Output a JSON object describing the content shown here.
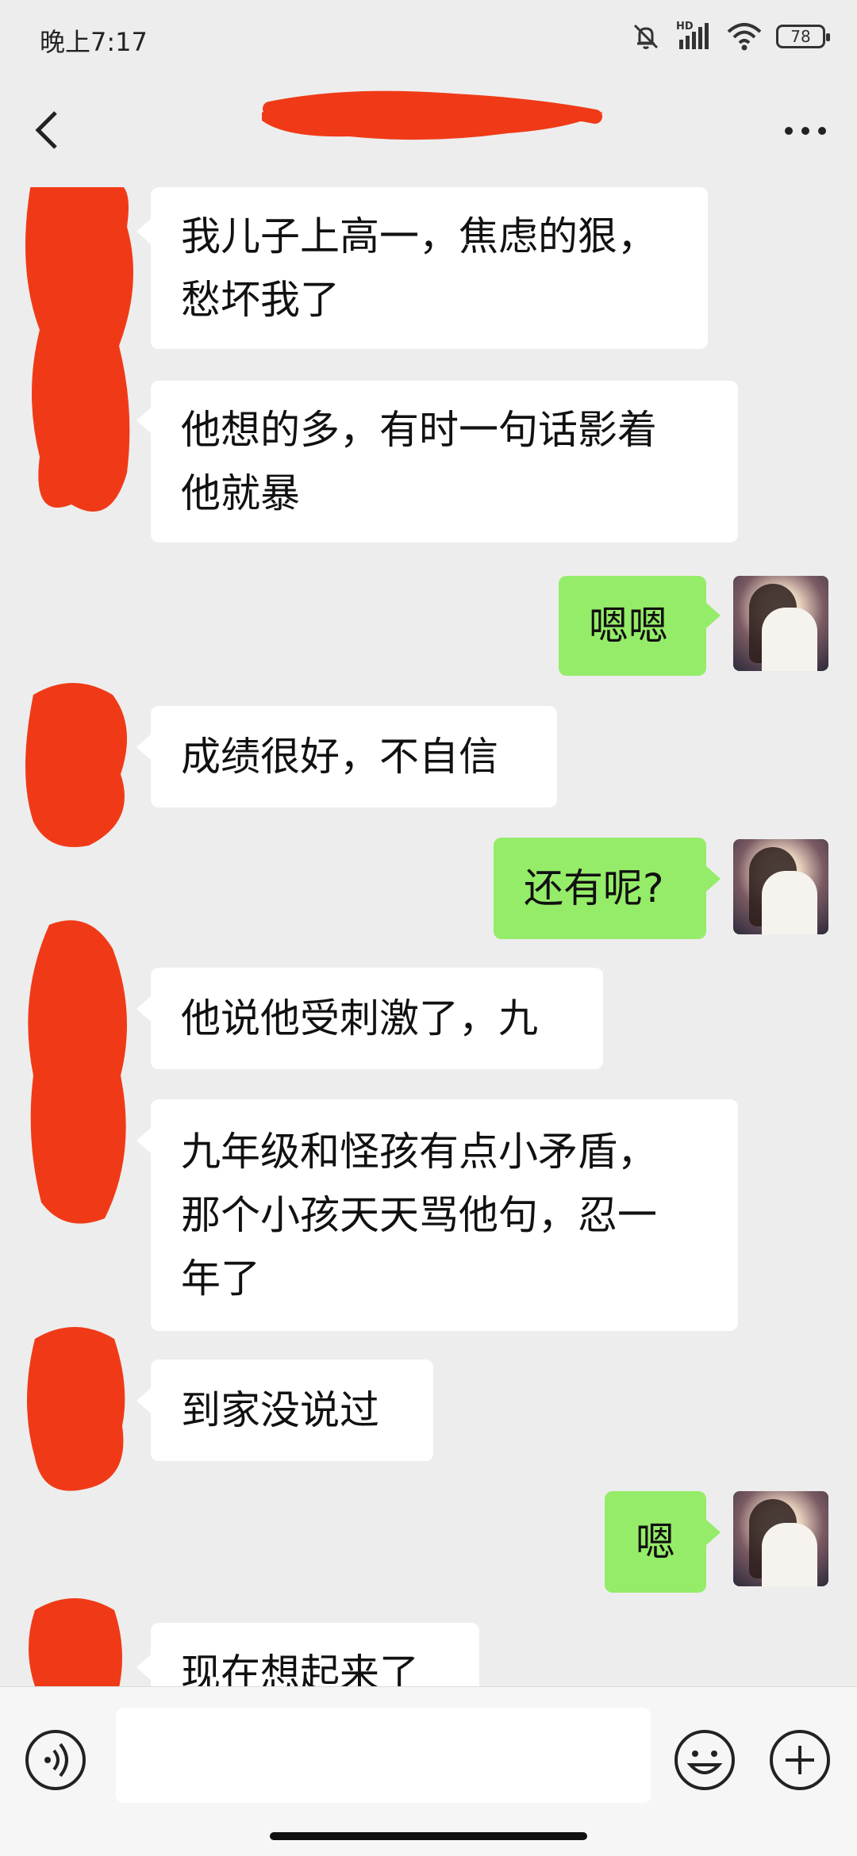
{
  "status_bar": {
    "time": "晚上7:17",
    "network_label": "HD",
    "battery": "78"
  },
  "header": {
    "title_redacted": true
  },
  "messages": [
    {
      "side": "in",
      "lines": [
        "我儿子上高一，焦虑的狠，",
        "愁坏我了"
      ]
    },
    {
      "side": "in",
      "lines": [
        "他想的多，有时一句话影着",
        "他就暴"
      ]
    },
    {
      "side": "out",
      "lines": [
        "嗯嗯"
      ]
    },
    {
      "side": "in",
      "lines": [
        "成绩很好，不自信"
      ]
    },
    {
      "side": "out",
      "lines": [
        "还有呢?"
      ]
    },
    {
      "side": "in",
      "lines": [
        "他说他受刺激了，九"
      ]
    },
    {
      "side": "in",
      "lines": [
        "九年级和怪孩有点小矛盾，",
        "那个小孩天天骂他句，忍一",
        "年了"
      ]
    },
    {
      "side": "in",
      "lines": [
        "到家没说过"
      ]
    },
    {
      "side": "out",
      "lines": [
        "嗯"
      ]
    },
    {
      "side": "in",
      "lines": [
        "现在想起来了"
      ]
    }
  ],
  "input_bar": {
    "placeholder": ""
  },
  "icons": {
    "back": "chevron-left-icon",
    "more": "more-dots-icon",
    "voice": "voice-icon",
    "emoji": "emoji-icon",
    "plus": "plus-icon"
  },
  "colors": {
    "background": "#ededed",
    "outgoing_bubble": "#95ec69",
    "incoming_bubble": "#ffffff",
    "redaction": "#f03a17"
  }
}
